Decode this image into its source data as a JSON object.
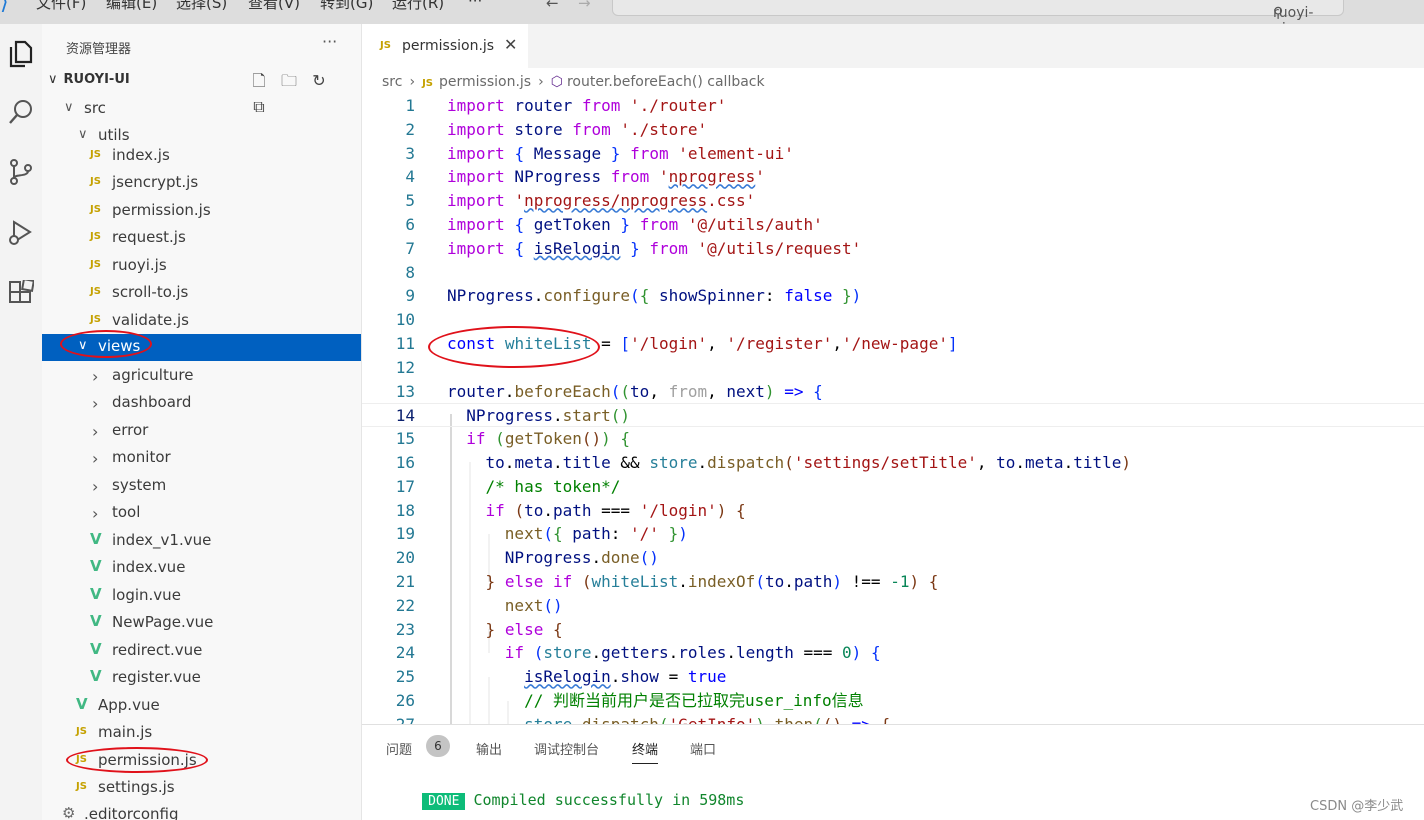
{
  "titlebar": {
    "menus": [
      "文件(F)",
      "编辑(E)",
      "选择(S)",
      "查看(V)",
      "转到(G)",
      "运行(R)",
      "···"
    ],
    "search_text": "ruoyi-ui"
  },
  "explorer": {
    "title": "资源管理器",
    "more": "···",
    "root": "RUOYI-UI",
    "items": [
      {
        "label": "src",
        "type": "folder",
        "open": true,
        "depth": 1
      },
      {
        "label": "utils",
        "type": "folder",
        "open": true,
        "depth": 2
      },
      {
        "label": "index.js",
        "type": "js",
        "depth": 3
      },
      {
        "label": "jsencrypt.js",
        "type": "js",
        "depth": 3
      },
      {
        "label": "permission.js",
        "type": "js",
        "depth": 3
      },
      {
        "label": "request.js",
        "type": "js",
        "depth": 3
      },
      {
        "label": "ruoyi.js",
        "type": "js",
        "depth": 3
      },
      {
        "label": "scroll-to.js",
        "type": "js",
        "depth": 3
      },
      {
        "label": "validate.js",
        "type": "js",
        "depth": 3
      },
      {
        "label": "views",
        "type": "folder",
        "open": true,
        "depth": 2,
        "selected": true
      },
      {
        "label": "agriculture",
        "type": "folder",
        "open": false,
        "depth": 3
      },
      {
        "label": "dashboard",
        "type": "folder",
        "open": false,
        "depth": 3
      },
      {
        "label": "error",
        "type": "folder",
        "open": false,
        "depth": 3
      },
      {
        "label": "monitor",
        "type": "folder",
        "open": false,
        "depth": 3
      },
      {
        "label": "system",
        "type": "folder",
        "open": false,
        "depth": 3
      },
      {
        "label": "tool",
        "type": "folder",
        "open": false,
        "depth": 3
      },
      {
        "label": "index_v1.vue",
        "type": "vue",
        "depth": 3
      },
      {
        "label": "index.vue",
        "type": "vue",
        "depth": 3
      },
      {
        "label": "login.vue",
        "type": "vue",
        "depth": 3
      },
      {
        "label": "NewPage.vue",
        "type": "vue",
        "depth": 3
      },
      {
        "label": "redirect.vue",
        "type": "vue",
        "depth": 3
      },
      {
        "label": "register.vue",
        "type": "vue",
        "depth": 3
      },
      {
        "label": "App.vue",
        "type": "vue",
        "depth": 2
      },
      {
        "label": "main.js",
        "type": "js",
        "depth": 2
      },
      {
        "label": "permission.js",
        "type": "js",
        "depth": 2
      },
      {
        "label": "settings.js",
        "type": "js",
        "depth": 2
      },
      {
        "label": ".editorconfig",
        "type": "config",
        "depth": 1
      }
    ]
  },
  "editor": {
    "tab_label": "permission.js",
    "file_icon": "JS",
    "breadcrumb": [
      "src",
      "permission.js",
      "router.beforeEach() callback"
    ],
    "lines": [
      [
        [
          "import",
          "i"
        ],
        [
          " router ",
          "v"
        ],
        [
          "from",
          "i"
        ],
        [
          " ",
          "p"
        ],
        [
          "'./router'",
          "s"
        ]
      ],
      [
        [
          "import",
          "i"
        ],
        [
          " store ",
          "v"
        ],
        [
          "from",
          "i"
        ],
        [
          " ",
          "p"
        ],
        [
          "'./store'",
          "s"
        ]
      ],
      [
        [
          "import",
          "i"
        ],
        [
          " ",
          "p"
        ],
        [
          "{",
          "br1"
        ],
        [
          " Message ",
          "v"
        ],
        [
          "}",
          "br1"
        ],
        [
          " ",
          "p"
        ],
        [
          "from",
          "i"
        ],
        [
          " ",
          "p"
        ],
        [
          "'element-ui'",
          "s"
        ]
      ],
      [
        [
          "import",
          "i"
        ],
        [
          " NProgress ",
          "v"
        ],
        [
          "from",
          "i"
        ],
        [
          " ",
          "p"
        ],
        [
          "'",
          "s"
        ],
        [
          "nprogress",
          "s sq"
        ],
        [
          "'",
          "s"
        ]
      ],
      [
        [
          "import",
          "i"
        ],
        [
          " ",
          "p"
        ],
        [
          "'",
          "s"
        ],
        [
          "nprogress/nprogress",
          "s sq"
        ],
        [
          ".css'",
          "s"
        ]
      ],
      [
        [
          "import",
          "i"
        ],
        [
          " ",
          "p"
        ],
        [
          "{",
          "br1"
        ],
        [
          " getToken ",
          "v"
        ],
        [
          "}",
          "br1"
        ],
        [
          " ",
          "p"
        ],
        [
          "from",
          "i"
        ],
        [
          " ",
          "p"
        ],
        [
          "'@/utils/auth'",
          "s"
        ]
      ],
      [
        [
          "import",
          "i"
        ],
        [
          " ",
          "p"
        ],
        [
          "{",
          "br1"
        ],
        [
          " ",
          "p"
        ],
        [
          "isRelogin",
          "v sq"
        ],
        [
          " ",
          "p"
        ],
        [
          "}",
          "br1"
        ],
        [
          " ",
          "p"
        ],
        [
          "from",
          "i"
        ],
        [
          " ",
          "p"
        ],
        [
          "'@/utils/request'",
          "s"
        ]
      ],
      [],
      [
        [
          "NProgress",
          "v"
        ],
        [
          ".",
          "p"
        ],
        [
          "configure",
          "f"
        ],
        [
          "(",
          "br1"
        ],
        [
          "{",
          "br2"
        ],
        [
          " showSpinner",
          "v"
        ],
        [
          ": ",
          "p"
        ],
        [
          "false",
          "k"
        ],
        [
          " ",
          "p"
        ],
        [
          "}",
          "br2"
        ],
        [
          ")",
          "br1"
        ]
      ],
      [],
      [
        [
          "const",
          "k"
        ],
        [
          " ",
          "p"
        ],
        [
          "whiteList",
          "c"
        ],
        [
          " = ",
          "p"
        ],
        [
          "[",
          "br1"
        ],
        [
          "'/login'",
          "s"
        ],
        [
          ", ",
          "p"
        ],
        [
          "'/register'",
          "s"
        ],
        [
          ",",
          "p"
        ],
        [
          "'/new-page'",
          "s"
        ],
        [
          "]",
          "br1"
        ]
      ],
      [],
      [
        [
          "router",
          "v"
        ],
        [
          ".",
          "p"
        ],
        [
          "beforeEach",
          "f"
        ],
        [
          "(",
          "br1"
        ],
        [
          "(",
          "br2"
        ],
        [
          "to",
          "v"
        ],
        [
          ", ",
          "p"
        ],
        [
          "from",
          "g"
        ],
        [
          ", ",
          "p"
        ],
        [
          "next",
          "v"
        ],
        [
          ")",
          "br2"
        ],
        [
          " ",
          "p"
        ],
        [
          "=>",
          "k"
        ],
        [
          " ",
          "p"
        ],
        [
          "{",
          "br1"
        ]
      ],
      [
        [
          "  NProgress",
          "v"
        ],
        [
          ".",
          "p"
        ],
        [
          "start",
          "f"
        ],
        [
          "()",
          "br2"
        ]
      ],
      [
        [
          "  ",
          "p"
        ],
        [
          "if",
          "i"
        ],
        [
          " ",
          "p"
        ],
        [
          "(",
          "br2"
        ],
        [
          "getToken",
          "f"
        ],
        [
          "()",
          "br3"
        ],
        [
          ")",
          "br2"
        ],
        [
          " ",
          "p"
        ],
        [
          "{",
          "br2"
        ]
      ],
      [
        [
          "    to",
          "v"
        ],
        [
          ".",
          "p"
        ],
        [
          "meta",
          "v"
        ],
        [
          ".",
          "p"
        ],
        [
          "title",
          "v"
        ],
        [
          " && ",
          "p"
        ],
        [
          "store",
          "c"
        ],
        [
          ".",
          "p"
        ],
        [
          "dispatch",
          "f"
        ],
        [
          "(",
          "br3"
        ],
        [
          "'settings/setTitle'",
          "s"
        ],
        [
          ", ",
          "p"
        ],
        [
          "to",
          "v"
        ],
        [
          ".",
          "p"
        ],
        [
          "meta",
          "v"
        ],
        [
          ".",
          "p"
        ],
        [
          "title",
          "v"
        ],
        [
          ")",
          "br3"
        ]
      ],
      [
        [
          "    ",
          "p"
        ],
        [
          "/* has token*/",
          "m"
        ]
      ],
      [
        [
          "    ",
          "p"
        ],
        [
          "if",
          "i"
        ],
        [
          " ",
          "p"
        ],
        [
          "(",
          "br3"
        ],
        [
          "to",
          "v"
        ],
        [
          ".",
          "p"
        ],
        [
          "path",
          "v"
        ],
        [
          " === ",
          "p"
        ],
        [
          "'/login'",
          "s"
        ],
        [
          ")",
          "br3"
        ],
        [
          " ",
          "p"
        ],
        [
          "{",
          "br3"
        ]
      ],
      [
        [
          "      ",
          "p"
        ],
        [
          "next",
          "f"
        ],
        [
          "(",
          "br1"
        ],
        [
          "{",
          "br2"
        ],
        [
          " path",
          "v"
        ],
        [
          ": ",
          "p"
        ],
        [
          "'/'",
          "s"
        ],
        [
          " ",
          "p"
        ],
        [
          "}",
          "br2"
        ],
        [
          ")",
          "br1"
        ]
      ],
      [
        [
          "      NProgress",
          "v"
        ],
        [
          ".",
          "p"
        ],
        [
          "done",
          "f"
        ],
        [
          "()",
          "br1"
        ]
      ],
      [
        [
          "    ",
          "p"
        ],
        [
          "}",
          "br3"
        ],
        [
          " ",
          "p"
        ],
        [
          "else",
          "i"
        ],
        [
          " ",
          "p"
        ],
        [
          "if",
          "i"
        ],
        [
          " ",
          "p"
        ],
        [
          "(",
          "br3"
        ],
        [
          "whiteList",
          "c"
        ],
        [
          ".",
          "p"
        ],
        [
          "indexOf",
          "f"
        ],
        [
          "(",
          "br1"
        ],
        [
          "to",
          "v"
        ],
        [
          ".",
          "p"
        ],
        [
          "path",
          "v"
        ],
        [
          ")",
          "br1"
        ],
        [
          " !== ",
          "p"
        ],
        [
          "-1",
          "n"
        ],
        [
          ")",
          "br3"
        ],
        [
          " ",
          "p"
        ],
        [
          "{",
          "br3"
        ]
      ],
      [
        [
          "      ",
          "p"
        ],
        [
          "next",
          "f"
        ],
        [
          "()",
          "br1"
        ]
      ],
      [
        [
          "    ",
          "p"
        ],
        [
          "}",
          "br3"
        ],
        [
          " ",
          "p"
        ],
        [
          "else",
          "i"
        ],
        [
          " ",
          "p"
        ],
        [
          "{",
          "br3"
        ]
      ],
      [
        [
          "      ",
          "p"
        ],
        [
          "if",
          "i"
        ],
        [
          " ",
          "p"
        ],
        [
          "(",
          "br1"
        ],
        [
          "store",
          "c"
        ],
        [
          ".",
          "p"
        ],
        [
          "getters",
          "v"
        ],
        [
          ".",
          "p"
        ],
        [
          "roles",
          "v"
        ],
        [
          ".",
          "p"
        ],
        [
          "length",
          "v"
        ],
        [
          " === ",
          "p"
        ],
        [
          "0",
          "n"
        ],
        [
          ")",
          "br1"
        ],
        [
          " ",
          "p"
        ],
        [
          "{",
          "br1"
        ]
      ],
      [
        [
          "        ",
          "p"
        ],
        [
          "isRelogin",
          "v sq"
        ],
        [
          ".",
          "p"
        ],
        [
          "show",
          "v"
        ],
        [
          " = ",
          "p"
        ],
        [
          "true",
          "k"
        ]
      ],
      [
        [
          "        ",
          "p"
        ],
        [
          "// 判断当前用户是否已拉取完user_info信息",
          "m"
        ]
      ],
      [
        [
          "        ",
          "p"
        ],
        [
          "store",
          "c"
        ],
        [
          ".",
          "p"
        ],
        [
          "dispatch",
          "f"
        ],
        [
          "(",
          "br2"
        ],
        [
          "'GetInfo'",
          "s"
        ],
        [
          ")",
          "br2"
        ],
        [
          ".",
          "p"
        ],
        [
          "then",
          "f"
        ],
        [
          "(",
          "br2"
        ],
        [
          "()",
          "br3"
        ],
        [
          " ",
          "p"
        ],
        [
          "=>",
          "k"
        ],
        [
          " ",
          "p"
        ],
        [
          "{",
          "br3"
        ]
      ]
    ]
  },
  "panel": {
    "tabs": [
      "问题",
      "输出",
      "调试控制台",
      "终端",
      "端口"
    ],
    "problems_count": "6",
    "active_tab": "终端",
    "done_label": "DONE",
    "message": "Compiled successfully in 598ms"
  },
  "watermark": "CSDN @李少武",
  "colors": {
    "annotation_red": "#e0111a",
    "selection_blue": "#0060c0",
    "done_green": "#0dbc79"
  }
}
